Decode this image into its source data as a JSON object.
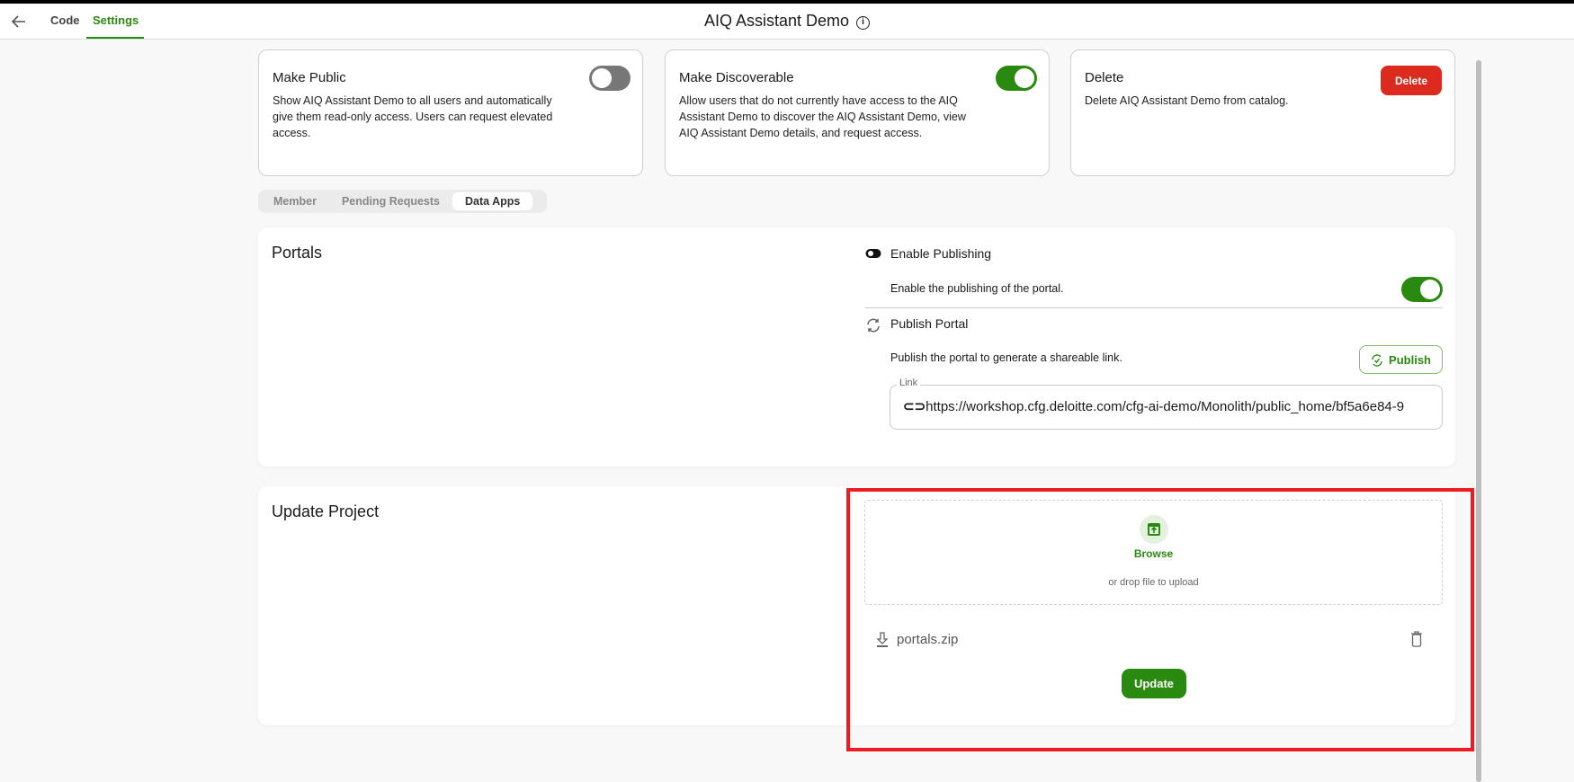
{
  "header": {
    "title": "AIQ Assistant Demo",
    "tabs": [
      {
        "label": "Code",
        "active": false
      },
      {
        "label": "Settings",
        "active": true
      }
    ]
  },
  "cards": [
    {
      "title": "Make Public",
      "description": "Show AIQ Assistant Demo to all users and automatically give them read-only access. Users can request elevated access.",
      "toggle_on": false
    },
    {
      "title": "Make Discoverable",
      "description": "Allow users that do not currently have access to the AIQ Assistant Demo to discover the AIQ Assistant Demo, view AIQ Assistant Demo details, and request access.",
      "toggle_on": true
    },
    {
      "title": "Delete",
      "description": "Delete AIQ Assistant Demo from catalog.",
      "button": "Delete"
    }
  ],
  "tabs": [
    {
      "label": "Member"
    },
    {
      "label": "Pending Requests"
    },
    {
      "label": "Data Apps",
      "active": true
    }
  ],
  "portals": {
    "title": "Portals",
    "enable_title": "Enable Publishing",
    "enable_desc": "Enable the publishing of the portal.",
    "enable_on": true,
    "publish_title": "Publish Portal",
    "publish_desc": "Publish the portal to generate a shareable link.",
    "publish_button": "Publish",
    "link_label": "Link",
    "link_value": "https://workshop.cfg.deloitte.com/cfg-ai-demo/Monolith/public_home/bf5a6e84-9"
  },
  "update": {
    "title": "Update Project",
    "browse": "Browse",
    "drop_text": "or drop file to upload",
    "file_name": "portals.zip",
    "button": "Update"
  },
  "colors": {
    "accent": "#2a8a10",
    "danger": "#dc2a1e",
    "highlight": "#ec1c24"
  }
}
